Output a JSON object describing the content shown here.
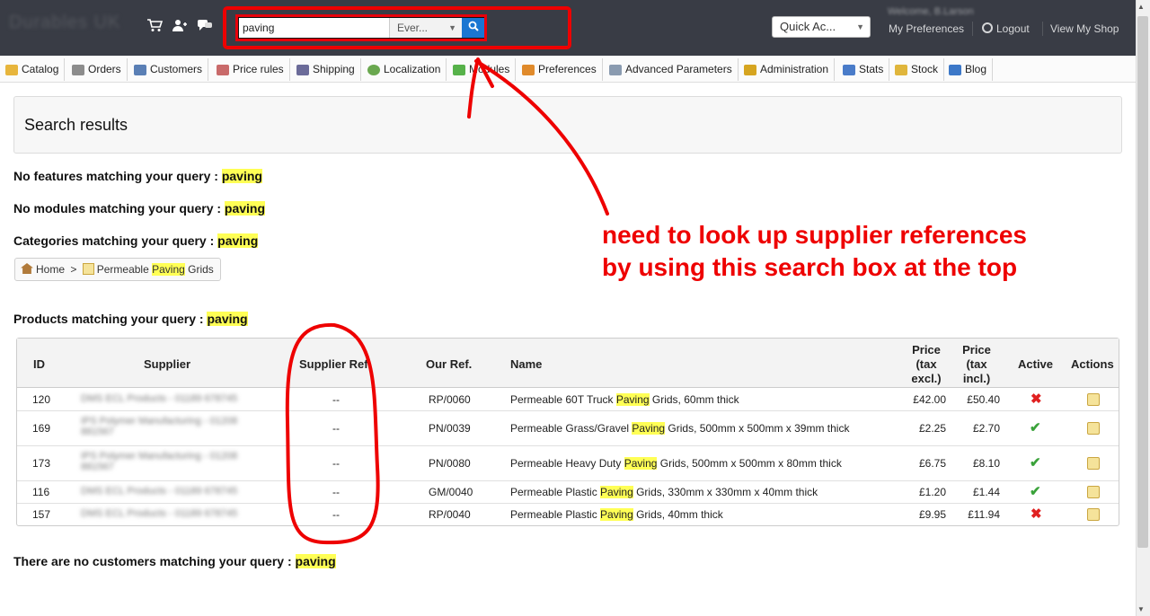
{
  "topbar": {
    "search_value": "paving",
    "search_scope": "Ever...",
    "quick_access": "Quick Ac...",
    "my_preferences": "My Preferences",
    "logout": "Logout",
    "view_my_shop": "View My Shop"
  },
  "menu": [
    {
      "label": "Catalog",
      "icon": "folder-icon",
      "color": "#e7b53c"
    },
    {
      "label": "Orders",
      "icon": "cart-icon",
      "color": "#8c8c8c"
    },
    {
      "label": "Customers",
      "icon": "user-icon",
      "color": "#5a7fb5"
    },
    {
      "label": "Price rules",
      "icon": "price-rule-icon",
      "color": "#c96a6a"
    },
    {
      "label": "Shipping",
      "icon": "truck-icon",
      "color": "#6b6b99"
    },
    {
      "label": "Localization",
      "icon": "globe-icon",
      "color": "#6aa84f"
    },
    {
      "label": "Modules",
      "icon": "puzzle-icon",
      "color": "#57b24a"
    },
    {
      "label": "Preferences",
      "icon": "preferences-icon",
      "color": "#e08a2b"
    },
    {
      "label": "Advanced Parameters",
      "icon": "wrench-icon",
      "color": "#8a9bb0"
    },
    {
      "label": "Administration",
      "icon": "key-icon",
      "color": "#d6a520"
    },
    {
      "label": "Stats",
      "icon": "chart-icon",
      "color": "#4a7cc9"
    },
    {
      "label": "Stock",
      "icon": "stock-icon",
      "color": "#e0b63c"
    },
    {
      "label": "Blog",
      "icon": "speech-icon",
      "color": "#3c78c8"
    }
  ],
  "content": {
    "results_title": "Search results",
    "no_features": "No features matching your query : ",
    "no_modules": "No modules matching your query : ",
    "categories": "Categories matching your query : ",
    "products": "Products matching your query : ",
    "no_customers": "There are no customers matching your query : ",
    "query": "paving",
    "breadcrumb_home": "Home",
    "breadcrumb_sep": ">",
    "breadcrumb_cat_pre": "Permeable ",
    "breadcrumb_cat_hl": "Paving",
    "breadcrumb_cat_post": " Grids"
  },
  "table": {
    "headers": {
      "id": "ID",
      "supplier": "Supplier",
      "supplier_ref": "Supplier Ref.",
      "our_ref": "Our Ref.",
      "name": "Name",
      "price_excl": [
        "Price",
        "(tax",
        "excl.)"
      ],
      "price_incl": [
        "Price",
        "(tax",
        "incl.)"
      ],
      "active": "Active",
      "actions": "Actions"
    },
    "rows": [
      {
        "id": "120",
        "supplier": "DMS ECL Products - 01189 678745",
        "supplier_ref": "--",
        "our_ref": "RP/0060",
        "name_pre": "Permeable 60T Truck ",
        "name_hl": "Paving",
        "name_post": " Grids, 60mm thick",
        "price_excl": "£42.00",
        "price_incl": "£50.40",
        "active": false
      },
      {
        "id": "169",
        "supplier": "IPS Polymer Manufacturing - 01208 881567",
        "supplier_ref": "--",
        "our_ref": "PN/0039",
        "name_pre": "Permeable Grass/Gravel ",
        "name_hl": "Paving",
        "name_post": " Grids, 500mm x 500mm x 39mm thick",
        "price_excl": "£2.25",
        "price_incl": "£2.70",
        "active": true
      },
      {
        "id": "173",
        "supplier": "IPS Polymer Manufacturing - 01208 881567",
        "supplier_ref": "--",
        "our_ref": "PN/0080",
        "name_pre": "Permeable Heavy Duty ",
        "name_hl": "Paving",
        "name_post": " Grids, 500mm x 500mm x 80mm thick",
        "price_excl": "£6.75",
        "price_incl": "£8.10",
        "active": true
      },
      {
        "id": "116",
        "supplier": "DMS ECL Products - 01189 678745",
        "supplier_ref": "--",
        "our_ref": "GM/0040",
        "name_pre": "Permeable Plastic ",
        "name_hl": "Paving",
        "name_post": " Grids, 330mm x 330mm x 40mm thick",
        "price_excl": "£1.20",
        "price_incl": "£1.44",
        "active": true
      },
      {
        "id": "157",
        "supplier": "DMS ECL Products - 01189 678745",
        "supplier_ref": "--",
        "our_ref": "RP/0040",
        "name_pre": "Permeable Plastic ",
        "name_hl": "Paving",
        "name_post": " Grids, 40mm thick",
        "price_excl": "£9.95",
        "price_incl": "£11.94",
        "active": false
      }
    ]
  },
  "annotation": {
    "line1": "need to look up supplier references",
    "line2": "by using this search box at the top",
    "color": "#ee0000"
  }
}
